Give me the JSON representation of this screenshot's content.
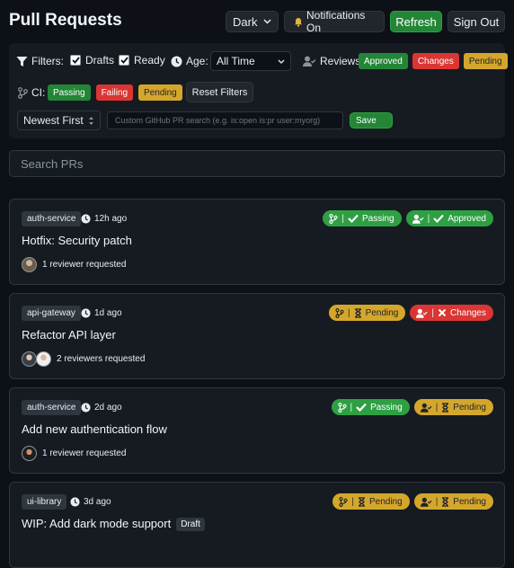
{
  "header": {
    "title": "Pull Requests",
    "theme_select": "Dark",
    "notifications": "Notifications On",
    "refresh": "Refresh",
    "sign_out": "Sign Out"
  },
  "filters": {
    "filters_label": "Filters:",
    "drafts_label": "Drafts",
    "ready_label": "Ready",
    "age_label": "Age:",
    "age_value": "All Time",
    "reviews_label": "Reviews:",
    "review_chips": [
      "Approved",
      "Changes",
      "Pending"
    ],
    "ci_label": "CI:",
    "ci_chips": [
      "Passing",
      "Failing",
      "Pending"
    ],
    "reset": "Reset Filters",
    "sort_value": "Newest First",
    "custom_search_placeholder": "Custom GitHub PR search (e.g. is:open is:pr user:myorg)",
    "save": "Save"
  },
  "search": {
    "placeholder": "Search PRs"
  },
  "prs": [
    {
      "repo": "auth-service",
      "age": "12h ago",
      "title": "Hotfix: Security patch",
      "reviewers": "1 reviewer requested",
      "ci": "Passing",
      "review": "Approved",
      "draft": ""
    },
    {
      "repo": "api-gateway",
      "age": "1d ago",
      "title": "Refactor API layer",
      "reviewers": "2 reviewers requested",
      "ci": "Pending",
      "review": "Changes",
      "draft": ""
    },
    {
      "repo": "auth-service",
      "age": "2d ago",
      "title": "Add new authentication flow",
      "reviewers": "1 reviewer requested",
      "ci": "Passing",
      "review": "Pending",
      "draft": ""
    },
    {
      "repo": "ui-library",
      "age": "3d ago",
      "title": "WIP: Add dark mode support",
      "reviewers": "",
      "ci": "Pending",
      "review": "Pending",
      "draft": "Draft"
    }
  ],
  "colors": {
    "green": "#238636",
    "red": "#da3633",
    "yellow": "#d4a72c",
    "bg": "#0d1117",
    "panel": "#161b22"
  }
}
